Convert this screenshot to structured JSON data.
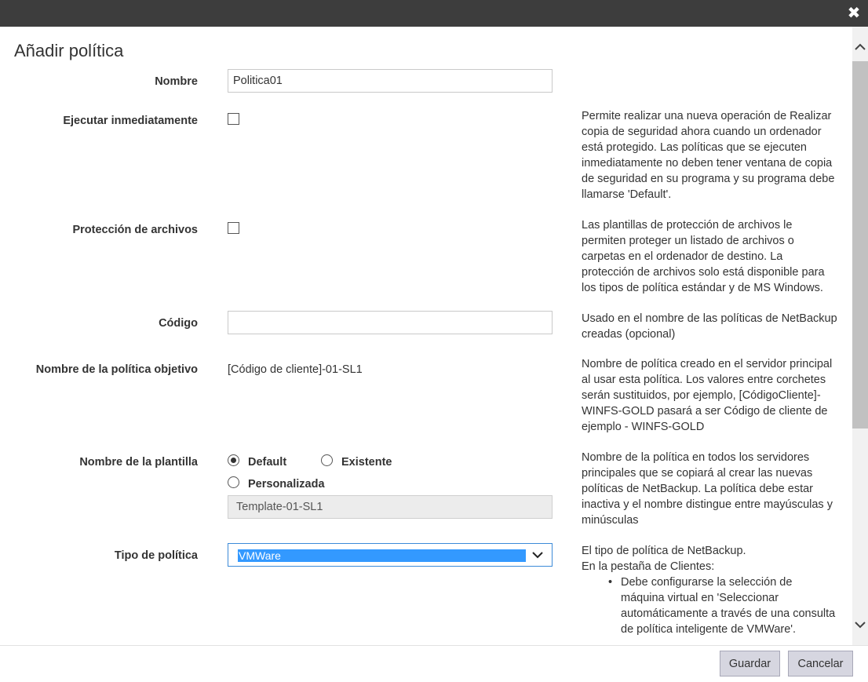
{
  "dialog": {
    "title": "Añadir política"
  },
  "form": {
    "nombre": {
      "label": "Nombre",
      "value": "Politica01"
    },
    "ejecutar": {
      "label": "Ejecutar inmediatamente",
      "checked": false,
      "help": "Permite realizar una nueva operación de Realizar copia de seguridad ahora cuando un ordenador está protegido. Las políticas que se ejecuten inmediatamente no deben tener ventana de copia de seguridad en su programa y su programa debe llamarse 'Default'."
    },
    "proteccion": {
      "label": "Protección de archivos",
      "checked": false,
      "help": "Las plantillas de protección de archivos le permiten proteger un listado de archivos o carpetas en el ordenador de destino. La protección de archivos solo está disponible para los tipos de política estándar y de MS Windows."
    },
    "codigo": {
      "label": "Código",
      "value": "",
      "help": "Usado en el nombre de las políticas de NetBackup creadas (opcional)"
    },
    "objetivo": {
      "label": "Nombre de la política objetivo",
      "value": "[Código de cliente]-01-SL1",
      "help": "Nombre de política creado en el servidor principal al usar esta política. Los valores entre corchetes serán sustituidos, por ejemplo, [CódigoCliente]-WINFS-GOLD pasará a ser Código de cliente de ejemplo - WINFS-GOLD"
    },
    "plantilla": {
      "label": "Nombre de la plantilla",
      "options": [
        "Default",
        "Existente",
        "Personalizada"
      ],
      "selected": "Default",
      "value": "Template-01-SL1",
      "help": "Nombre de la política en todos los servidores principales que se copiará al crear las nuevas políticas de NetBackup. La política debe estar inactiva y el nombre distingue entre mayúsculas y minúsculas"
    },
    "tipo": {
      "label": "Tipo de política",
      "value": "VMWare",
      "help_line1": "El tipo de política de NetBackup.",
      "help_line2": "En la pestaña de Clientes:",
      "help_bullet": "Debe configurarse la selección de máquina virtual en 'Seleccionar automáticamente a través de una consulta de política inteligente de VMWare'."
    }
  },
  "footer": {
    "save_label": "Guardar",
    "cancel_label": "Cancelar"
  }
}
